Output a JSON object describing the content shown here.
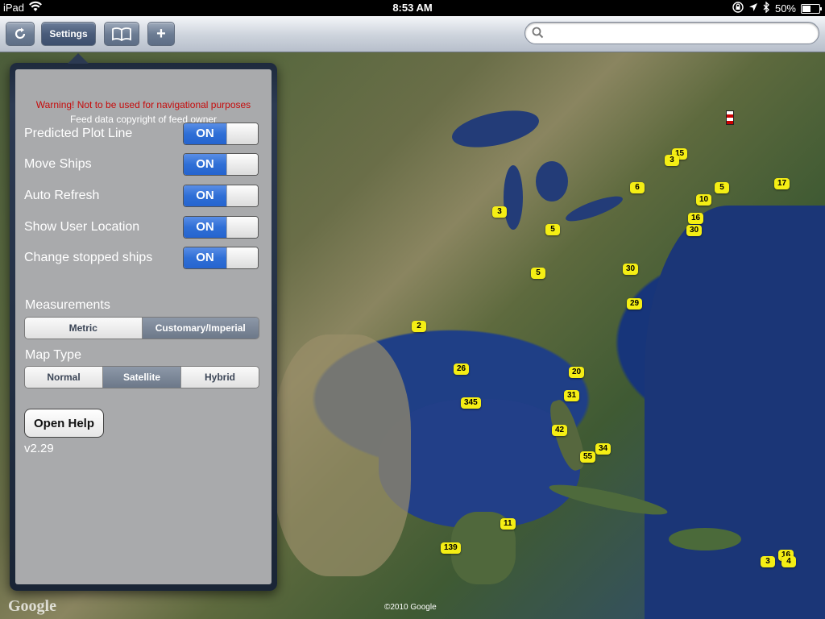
{
  "status_bar": {
    "carrier": "iPad",
    "time": "8:53 AM",
    "battery": "50%",
    "battery_level": 0.5
  },
  "toolbar": {
    "settings_label": "Settings",
    "add_label": "+",
    "search_placeholder": ""
  },
  "settings": {
    "warning": "Warning! Not to be used for navigational purposes",
    "copyright_note": "Feed data copyright of feed owner",
    "toggles": [
      {
        "label": "Predicted Plot Line",
        "state": "ON"
      },
      {
        "label": "Move Ships",
        "state": "ON"
      },
      {
        "label": "Auto Refresh",
        "state": "ON"
      },
      {
        "label": "Show User Location",
        "state": "ON"
      },
      {
        "label": "Change stopped ships",
        "state": "ON"
      }
    ],
    "measurements_title": "Measurements",
    "measurements": {
      "options": [
        "Metric",
        "Customary/Imperial"
      ],
      "selected": "Customary/Imperial"
    },
    "map_type_title": "Map Type",
    "map_type": {
      "options": [
        "Normal",
        "Satellite",
        "Hybrid"
      ],
      "selected": "Satellite"
    },
    "help_label": "Open Help",
    "version": "v2.29"
  },
  "map": {
    "logo": "Google",
    "copyright": "©2010 Google",
    "markers": [
      "15",
      "3",
      "6",
      "5",
      "10",
      "17",
      "16",
      "30",
      "3",
      "5",
      "5",
      "30",
      "29",
      "2",
      "20",
      "26",
      "31",
      "345",
      "42",
      "34",
      "55",
      "11",
      "139",
      "3",
      "16",
      "4"
    ]
  }
}
